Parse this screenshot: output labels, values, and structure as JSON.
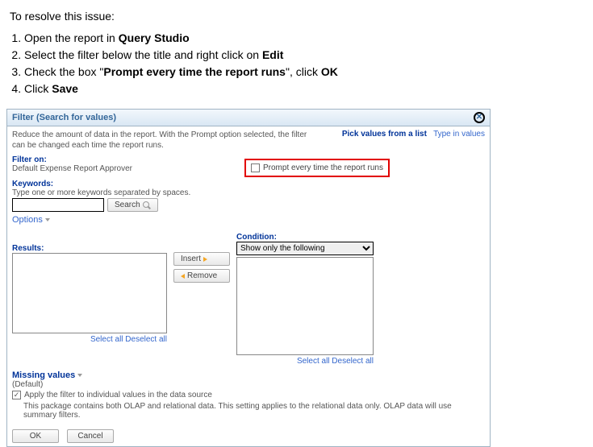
{
  "instructions": {
    "intro": "To resolve this issue:",
    "step1_a": "Open the report in ",
    "step1_b": "Query Studio",
    "step2_a": "Select the filter below the title and right click on ",
    "step2_b": "Edit",
    "step3_a": "Check the box \"",
    "step3_b": "Prompt every time the report runs",
    "step3_c": "\", click ",
    "step3_d": "OK",
    "step4_a": "Click ",
    "step4_b": "Save"
  },
  "panel": {
    "title": "Filter (Search for values)",
    "desc": "Reduce the amount of data in the report. With the Prompt option selected, the filter can be changed each time the report runs."
  },
  "pick": {
    "label": "Pick values from a list",
    "link": "Type in values"
  },
  "filterOn": {
    "label": "Filter on:",
    "value": "Default Expense Report Approver"
  },
  "prompt": {
    "label": "Prompt every time the report runs"
  },
  "keywords": {
    "label": "Keywords:",
    "hint": "Type one or more keywords separated by spaces.",
    "value": "",
    "search": "Search",
    "options": "Options"
  },
  "condition": {
    "label": "Condition:",
    "value": "Show only the following"
  },
  "results": {
    "label": "Results:"
  },
  "insert": {
    "label": "Insert"
  },
  "remove": {
    "label": "Remove"
  },
  "selAll": "Select all",
  "deselAll": "Deselect all",
  "missing": {
    "label": "Missing values",
    "default": "(Default)"
  },
  "apply": {
    "label": "Apply the filter to individual values in the data source"
  },
  "note": "This package contains both OLAP and relational data. This setting applies to the relational data only. OLAP data will use summary filters.",
  "ok": "OK",
  "cancel": "Cancel"
}
